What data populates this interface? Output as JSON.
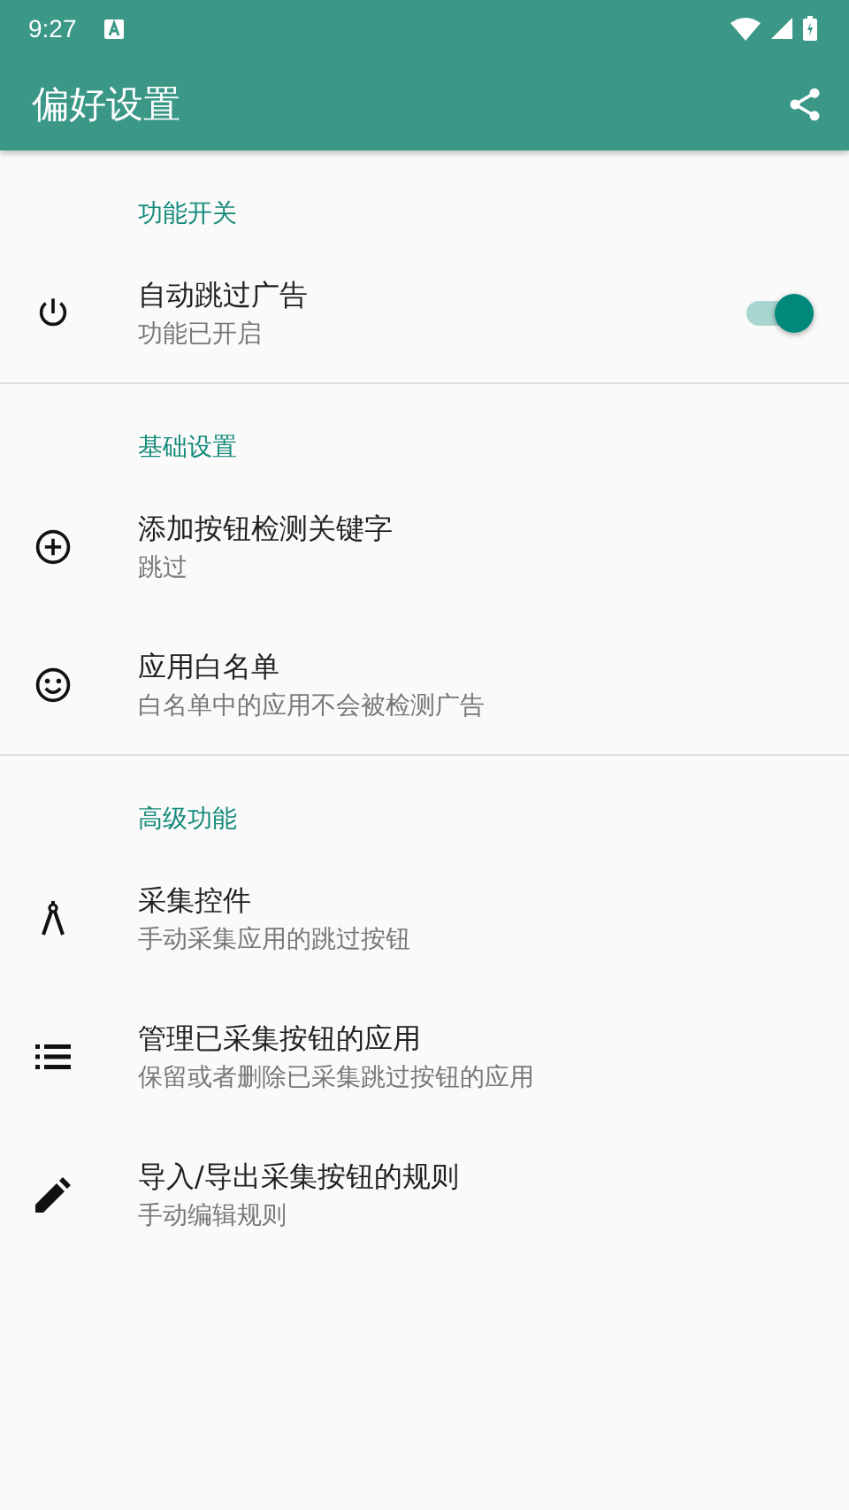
{
  "status_bar": {
    "time": "9:27"
  },
  "app_bar": {
    "title": "偏好设置"
  },
  "sections": [
    {
      "title": "功能开关",
      "items": [
        {
          "kind": "switch",
          "title": "自动跳过广告",
          "summary": "功能已开启",
          "on": true
        }
      ]
    },
    {
      "title": "基础设置",
      "items": [
        {
          "kind": "plain",
          "title": "添加按钮检测关键字",
          "summary": "跳过"
        },
        {
          "kind": "plain",
          "title": "应用白名单",
          "summary": "白名单中的应用不会被检测广告"
        }
      ]
    },
    {
      "title": "高级功能",
      "items": [
        {
          "kind": "plain",
          "title": "采集控件",
          "summary": "手动采集应用的跳过按钮"
        },
        {
          "kind": "plain",
          "title": "管理已采集按钮的应用",
          "summary": "保留或者删除已采集跳过按钮的应用"
        },
        {
          "kind": "plain",
          "title": "导入/导出采集按钮的规则",
          "summary": "手动编辑规则"
        }
      ]
    }
  ]
}
